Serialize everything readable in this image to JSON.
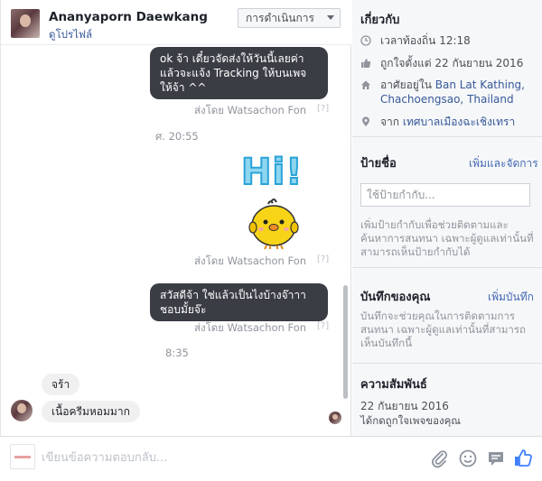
{
  "header": {
    "name": "Ananyaporn Daewkang",
    "profile_link": "ดูโปรไฟล์",
    "actions_label": "การดำเนินการ"
  },
  "thread": {
    "messages": [
      {
        "side": "out",
        "text": "ok จ้า เดี๋ยวจัดส่งให้วันนี้เลยค่า แล้วจะแจ้ง Tracking ให้บนเพจให้จ้า ^^"
      },
      {
        "side": "out",
        "text": "สวัสดีจ้า ใช่แล้วเป็นไงบ้างจ๊าาา ชอบมั้ยจ๊ะ"
      },
      {
        "side": "in",
        "text": "จร้า"
      },
      {
        "side": "in",
        "text": "เนื้อครีมหอมมาก"
      }
    ],
    "sent_by": "ส่งโดย Watsachon Fon",
    "seen_mark": "[?]",
    "timestamps": [
      "ศ. 20:55",
      "8:35"
    ],
    "sticker_text": "Hi!"
  },
  "about": {
    "title": "เกี่ยวกับ",
    "local_time": "เวลาท้องถิ่น 12:18",
    "liked_date": "ถูกใจตั้งแต่ 22 กันยายน 2016",
    "lives_prefix": "อาศัยอยู่ใน",
    "lives_location": "Ban Lat Kathing, Chachoengsao, Thailand",
    "from_prefix": "จาก",
    "from_location": "เทศบาลเมืองฉะเชิงเทรา"
  },
  "tags": {
    "title": "ป้ายชื่อ",
    "manage_link": "เพิ่มและจัดการ",
    "input_placeholder": "ใช้ป้ายกำกับ...",
    "help": "เพิ่มป้ายกำกับเพื่อช่วยติดตามและค้นหาการสนทนา เฉพาะผู้ดูแลเท่านั้นที่สามารถเห็นป้ายกำกับได้"
  },
  "notes": {
    "title": "บันทึกของคุณ",
    "add_link": "เพิ่มบันทึก",
    "help": "บันทึกจะช่วยคุณในการติดตามการสนทนา เฉพาะผู้ดูแลเท่านั้นที่สามารถเห็นบันทึกนี้"
  },
  "relationship": {
    "title": "ความสัมพันธ์",
    "date": "22 กันยายน 2016",
    "desc": "ได้กดถูกใจเพจของคุณ"
  },
  "composer": {
    "placeholder": "เขียนข้อความตอบกลับ..."
  },
  "colors": {
    "outgoing_bubble": "#3a3d44",
    "incoming_bubble": "#f1f0f0",
    "link": "#365899",
    "accent": "#4267b2"
  }
}
